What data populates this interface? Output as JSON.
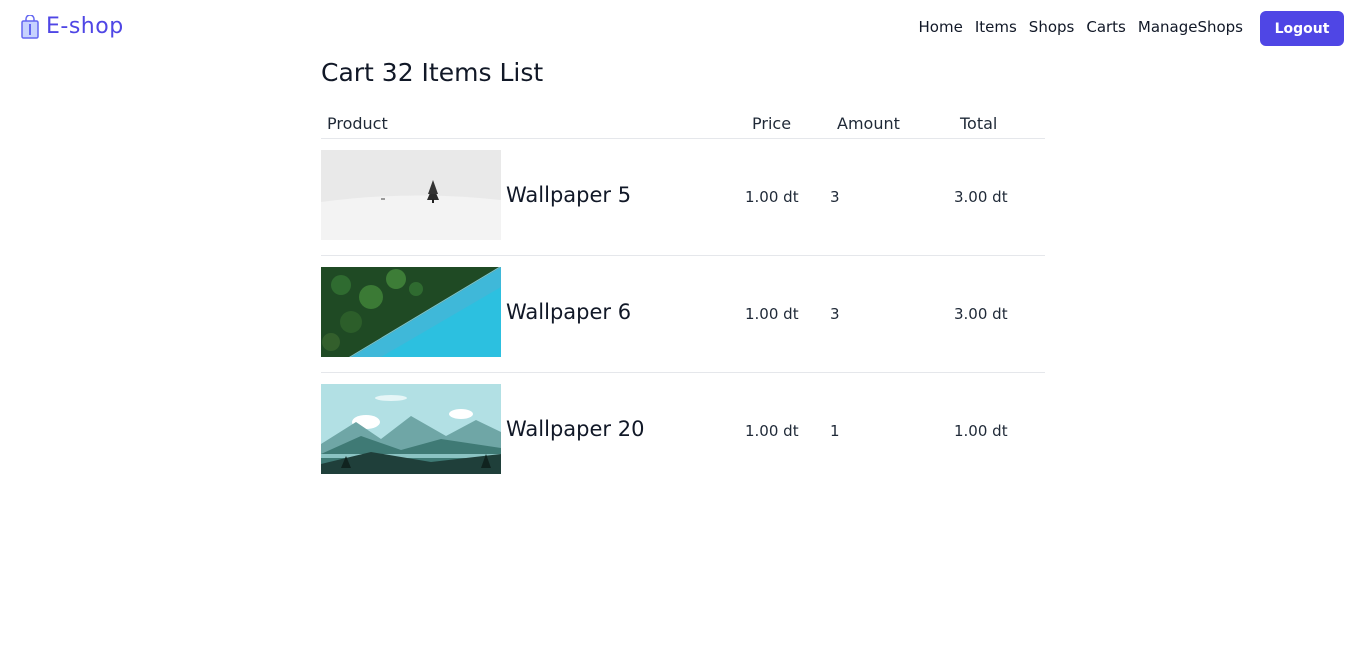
{
  "brand": {
    "name": "E-shop",
    "icon": "shopping-bag-icon",
    "color": "#4f46e5"
  },
  "nav": {
    "links": [
      "Home",
      "Items",
      "Shops",
      "Carts",
      "ManageShops"
    ],
    "logout_label": "Logout",
    "logout_color": "#4f46e5"
  },
  "page": {
    "title": "Cart 32 Items List"
  },
  "table": {
    "headers": {
      "product": "Product",
      "price": "Price",
      "amount": "Amount",
      "total": "Total"
    },
    "rows": [
      {
        "name": "Wallpaper 5",
        "price": "1.00 dt",
        "amount": "3",
        "total": "3.00 dt",
        "thumb": "snow-tree-image"
      },
      {
        "name": "Wallpaper 6",
        "price": "1.00 dt",
        "amount": "3",
        "total": "3.00 dt",
        "thumb": "forest-lake-image"
      },
      {
        "name": "Wallpaper 20",
        "price": "1.00 dt",
        "amount": "1",
        "total": "1.00 dt",
        "thumb": "mountain-landscape-image"
      }
    ]
  }
}
